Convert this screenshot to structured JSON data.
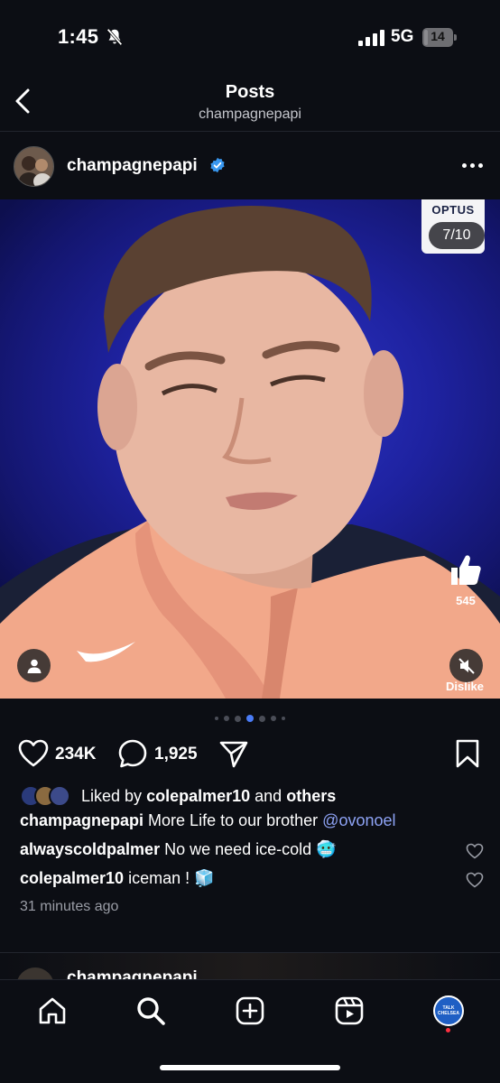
{
  "status_bar": {
    "time": "1:45",
    "network": "5G",
    "battery_level": "14",
    "battery_fraction": 0.14
  },
  "header": {
    "title": "Posts",
    "subtitle": "champagnepapi"
  },
  "post": {
    "username": "champagnepapi",
    "verified": true,
    "media": {
      "sponsor_text": "OPTUS",
      "page_counter": "7/10",
      "overlay_like_count": "545",
      "overlay_dislike_label": "Dislike",
      "carousel_total": 7,
      "carousel_active_index": 3
    },
    "actions": {
      "likes": "234K",
      "comments": "1,925"
    },
    "liked_by": {
      "prefix": "Liked by",
      "user": "colepalmer10",
      "and": "and",
      "others": "others"
    },
    "caption": {
      "user": "champagnepapi",
      "text": "More Life to our brother",
      "mention": "@ovonoel"
    },
    "comments": [
      {
        "user": "alwayscoldpalmer",
        "text": "No we need ice-cold 🥶"
      },
      {
        "user": "colepalmer10",
        "text": "iceman ! 🧊"
      }
    ],
    "timestamp": "31 minutes ago"
  },
  "next_post": {
    "username": "champagnepapi"
  },
  "tab_bar": {
    "tabs": [
      "home",
      "search",
      "create",
      "reels",
      "profile"
    ],
    "profile_avatar_text": [
      "TALK",
      "CHELSEA"
    ]
  },
  "colors": {
    "background": "#0c0e14",
    "mention": "#8ea3f5",
    "verified": "#3897f0",
    "active_dot": "#4a7cf7",
    "notification": "#ff3040"
  }
}
